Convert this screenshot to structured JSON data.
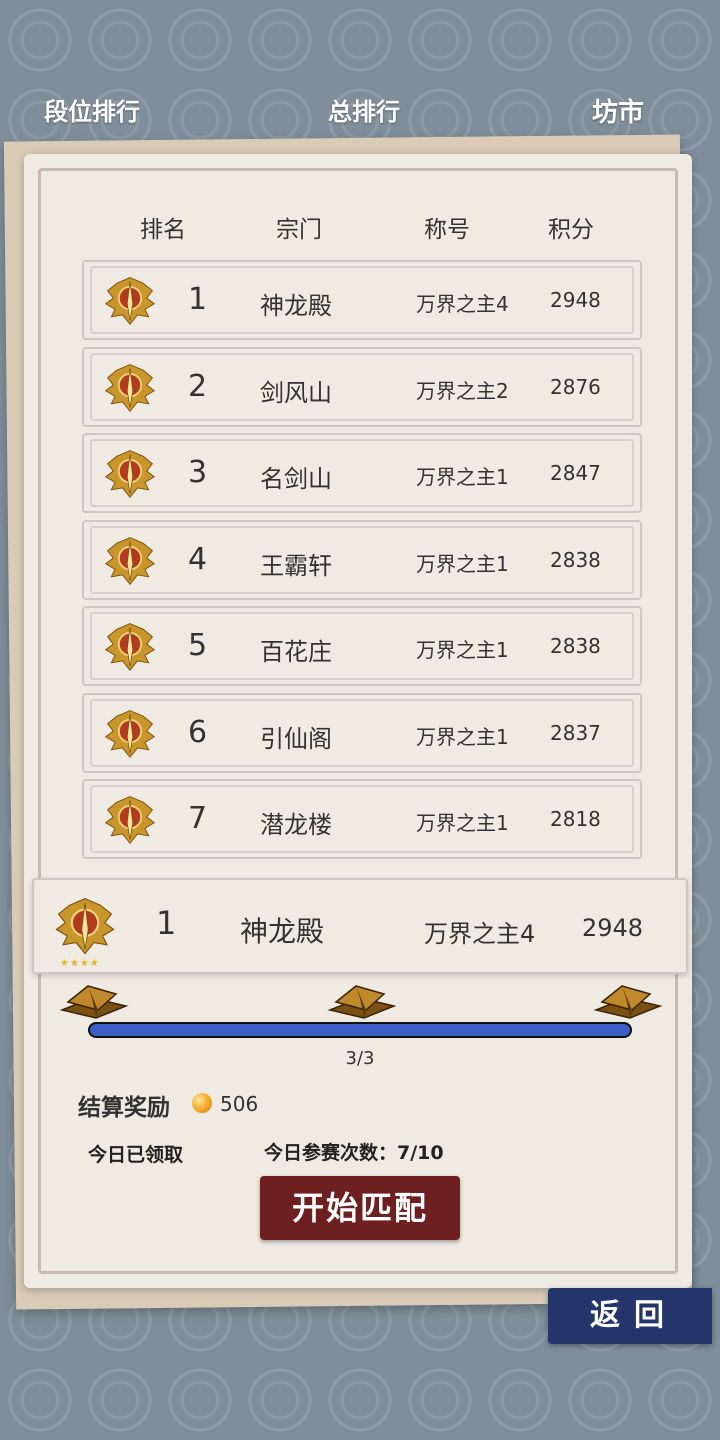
{
  "tabs": {
    "rank_level": "段位排行",
    "rank_total": "总排行",
    "market": "坊市"
  },
  "table": {
    "headers": {
      "rank": "排名",
      "sect": "宗门",
      "title": "称号",
      "score": "积分"
    },
    "rows": [
      {
        "rank": "1",
        "sect": "神龙殿",
        "title": "万界之主4",
        "score": "2948"
      },
      {
        "rank": "2",
        "sect": "剑风山",
        "title": "万界之主2",
        "score": "2876"
      },
      {
        "rank": "3",
        "sect": "名剑山",
        "title": "万界之主1",
        "score": "2847"
      },
      {
        "rank": "4",
        "sect": "王霸轩",
        "title": "万界之主1",
        "score": "2838"
      },
      {
        "rank": "5",
        "sect": "百花庄",
        "title": "万界之主1",
        "score": "2838"
      },
      {
        "rank": "6",
        "sect": "引仙阁",
        "title": "万界之主1",
        "score": "2837"
      },
      {
        "rank": "7",
        "sect": "潜龙楼",
        "title": "万界之主1",
        "score": "2818"
      }
    ]
  },
  "my_rank": {
    "rank": "1",
    "sect": "神龙殿",
    "title": "万界之主4",
    "score": "2948",
    "stars": "★★★★"
  },
  "progress": {
    "text": "3/3",
    "fraction": 1.0
  },
  "reward": {
    "label": "结算奖励",
    "value": "506",
    "icon": "coin-icon"
  },
  "status": {
    "claimed": "今日已领取",
    "match_count": "今日参赛次数：7/10"
  },
  "buttons": {
    "start": "开始匹配",
    "back": "返回"
  },
  "colors": {
    "start_button": "#6e1f1f",
    "back_button": "#23356b",
    "progress": "#3b5fc4"
  }
}
